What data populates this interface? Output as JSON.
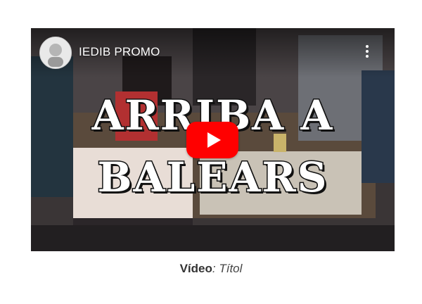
{
  "video": {
    "channel_name": "IEDIB PROMO",
    "thumbnail_text_line1": "ARRIBA A",
    "thumbnail_text_line2": "BALEARS",
    "menu_icon": "more-vert-icon",
    "play_icon": "youtube-play-icon",
    "play_color": "#ff0000"
  },
  "caption": {
    "label": "Vídeo",
    "separator": ": ",
    "title": "Títol"
  }
}
